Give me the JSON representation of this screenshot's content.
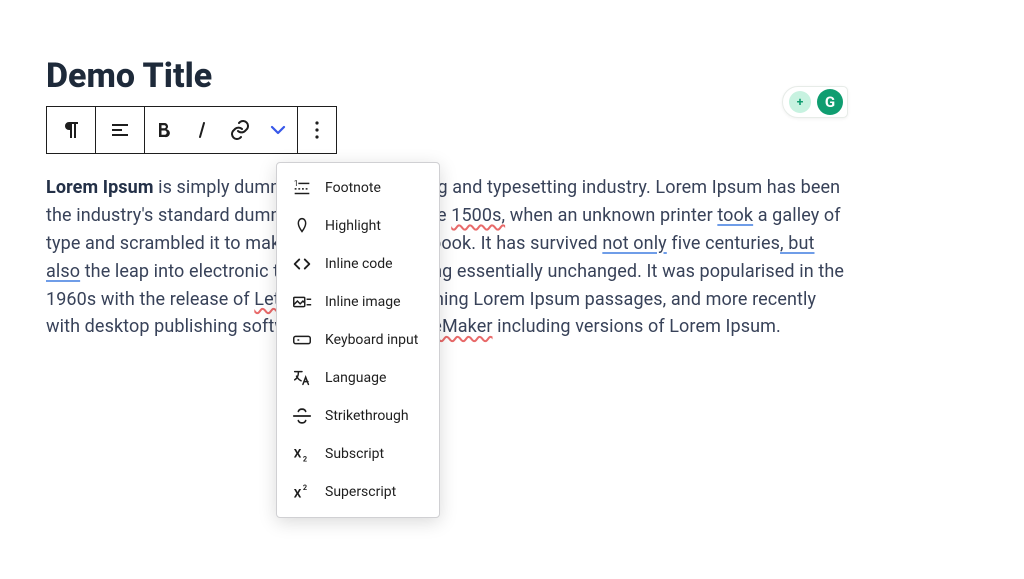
{
  "title": "Demo Title",
  "toolbar": {
    "paragraph_icon": "paragraph",
    "align_icon": "align-left",
    "bold_icon": "bold",
    "italic_icon": "italic",
    "link_icon": "link",
    "more_dropdown_icon": "chevron-down",
    "options_icon": "more-vertical"
  },
  "dropdown": {
    "items": [
      {
        "icon": "footnote",
        "label": "Footnote"
      },
      {
        "icon": "highlight",
        "label": "Highlight"
      },
      {
        "icon": "inline-code",
        "label": "Inline code"
      },
      {
        "icon": "inline-image",
        "label": "Inline image"
      },
      {
        "icon": "keyboard-input",
        "label": "Keyboard input"
      },
      {
        "icon": "language",
        "label": "Language"
      },
      {
        "icon": "strikethrough",
        "label": "Strikethrough"
      },
      {
        "icon": "subscript",
        "label": "Subscript"
      },
      {
        "icon": "superscript",
        "label": "Superscript"
      }
    ]
  },
  "paragraph": {
    "bold_lead": "Lorem Ipsum",
    "frag1": " is simply dummy text of the printing and typesetting industry. Lorem Ipsum has been the industry's standard dummy text ever since the ",
    "red1": "1500s,",
    "frag2": " when an unknown printer ",
    "blue1": "took",
    "frag3": " a galley of type and scrambled it to make a type specimen book. It has survived ",
    "blue2": "not only",
    "frag4": " five centuries",
    "blue3": ", but also",
    "frag5": " the leap into electronic typesetting, remaining essentially unchanged. It was popularised in the 1960s with the release of ",
    "red2": "Letraset",
    "frag6": " sheets containing Lorem Ipsum passages, and more recently with desktop publishing software like ",
    "red3": "Aldus PageMaker",
    "frag7": " including versions of Lorem Ipsum."
  },
  "badge": {
    "plus": "+",
    "g": "G"
  }
}
